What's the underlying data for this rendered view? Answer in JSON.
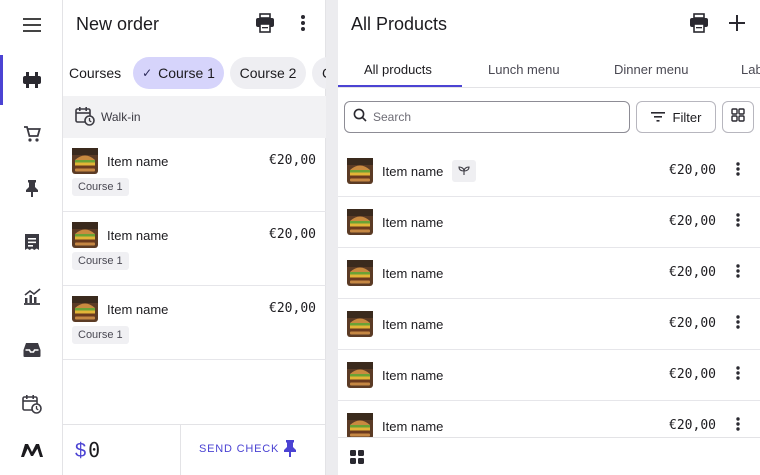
{
  "rail": {
    "items": [
      {
        "icon": "menu-icon"
      },
      {
        "icon": "table-service-icon",
        "active": true
      },
      {
        "icon": "cart-icon"
      },
      {
        "icon": "pin-icon"
      },
      {
        "icon": "receipt-icon"
      },
      {
        "icon": "analytics-icon"
      },
      {
        "icon": "inbox-icon"
      },
      {
        "icon": "calendar-clock-icon"
      },
      {
        "icon": "brand-logo-icon"
      }
    ]
  },
  "order": {
    "title": "New order",
    "courses_label": "Courses",
    "chips": [
      {
        "label": "Course 1",
        "selected": true
      },
      {
        "label": "Course 2",
        "selected": false
      },
      {
        "label": "C",
        "selected": false
      }
    ],
    "walkin_label": "Walk-in",
    "items": [
      {
        "name": "Item name",
        "price": "€20,00",
        "course": "Course 1"
      },
      {
        "name": "Item name",
        "price": "€20,00",
        "course": "Course 1"
      },
      {
        "name": "Item name",
        "price": "€20,00",
        "course": "Course 1"
      }
    ],
    "total_currency": "$",
    "total_value": "0",
    "send_check_label": "SEND CHECK"
  },
  "products": {
    "title": "All Products",
    "tabs": [
      "All products",
      "Lunch menu",
      "Dinner menu",
      "Lab"
    ],
    "active_tab": 0,
    "search_placeholder": "Search",
    "filter_label": "Filter",
    "items": [
      {
        "name": "Item name",
        "price": "€20,00",
        "badge": "sprout-icon"
      },
      {
        "name": "Item name",
        "price": "€20,00"
      },
      {
        "name": "Item name",
        "price": "€20,00"
      },
      {
        "name": "Item name",
        "price": "€20,00"
      },
      {
        "name": "Item name",
        "price": "€20,00"
      },
      {
        "name": "Item name",
        "price": "€20,00"
      }
    ]
  },
  "colors": {
    "accent": "#4b43d3",
    "chip_selected": "#d6d4fb",
    "divider": "#e3e3e6"
  }
}
